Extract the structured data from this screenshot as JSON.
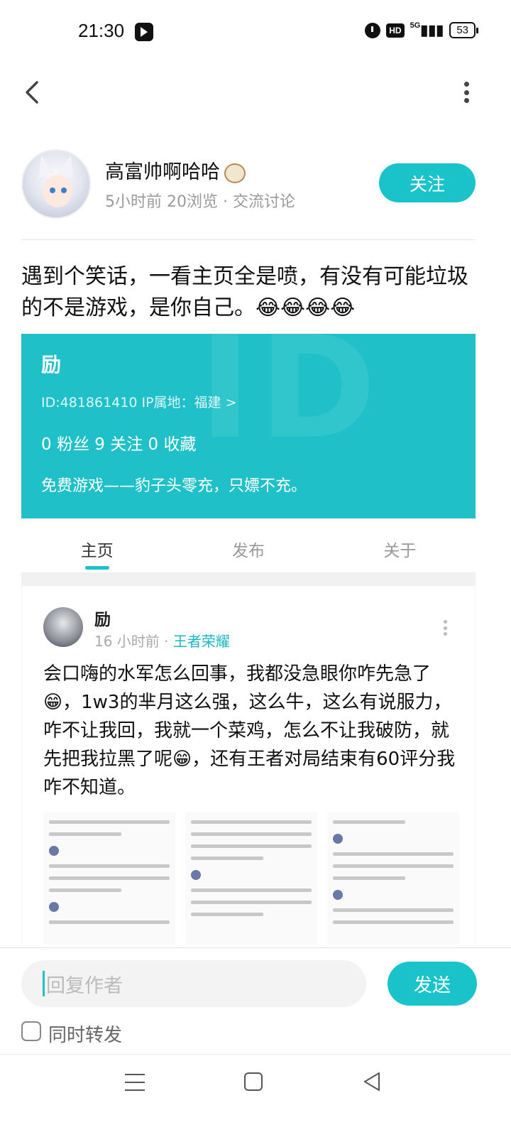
{
  "status_bar": {
    "time": "21:30",
    "network": "5G",
    "hd": "HD",
    "battery": "53"
  },
  "author": {
    "name": "高富帅啊哈哈",
    "meta": "5小时前  20浏览 · 交流讨论",
    "follow_label": "关注"
  },
  "post": {
    "text": "遇到个笑话，一看主页全是喷，有没有可能垃圾的不是游戏，是你自己。😂😂😂😂"
  },
  "embedded_profile": {
    "name": "励",
    "ids": "ID:481861410    IP属地：福建 >",
    "stats": "0 粉丝    9 关注    0 收藏",
    "bio": "免费游戏——豹子头零充，只嫖不充。",
    "tabs": [
      {
        "label": "主页",
        "active": true
      },
      {
        "label": "发布",
        "active": false
      },
      {
        "label": "关于",
        "active": false
      }
    ]
  },
  "embedded_post": {
    "author": "励",
    "time": "16 小时前",
    "sep": " · ",
    "game": "王者荣耀",
    "text": "会口嗨的水军怎么回事，我都没急眼你咋先急了😁，1w3的芈月这么强，这么牛，这么有说服力，咋不让我回，我就一个菜鸡，怎么不让我破防，就先把我拉黑了呢😁，还有王者对局结束有60评分我咋不知道。"
  },
  "reply": {
    "placeholder": "回复作者",
    "send_label": "发送",
    "repost_label": "同时转发"
  },
  "colors": {
    "accent": "#19c3c9"
  }
}
